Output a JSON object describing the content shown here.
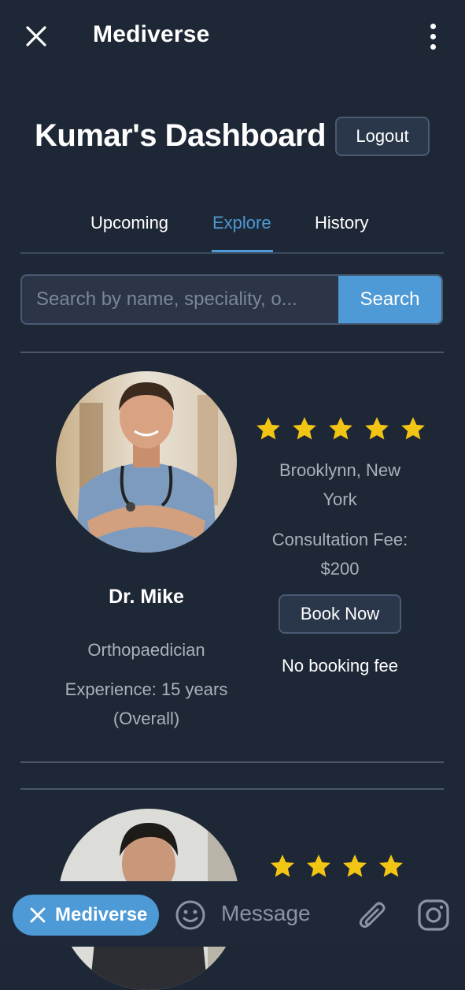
{
  "topbar": {
    "app_title": "Mediverse"
  },
  "dashboard": {
    "title": "Kumar's Dashboard",
    "logout_label": "Logout"
  },
  "tabs": [
    {
      "label": "Upcoming",
      "active": false
    },
    {
      "label": "Explore",
      "active": true
    },
    {
      "label": "History",
      "active": false
    }
  ],
  "search": {
    "placeholder": "Search by name, speciality, o...",
    "button_label": "Search"
  },
  "doctors": [
    {
      "name": "Dr.  Mike",
      "speciality": "Orthopaedician",
      "experience_line1": "Experience: 15 years",
      "experience_line2": "(Overall)",
      "rating": 5,
      "location_line1": "Brooklynn, New",
      "location_line2": "York",
      "fee_line1": "Consultation Fee:",
      "fee_line2": "$200",
      "book_label": "Book Now",
      "booking_note": "No booking fee"
    },
    {
      "rating": 4
    }
  ],
  "bottom_bar": {
    "chip_label": "Mediverse",
    "message_placeholder": "Message"
  },
  "colors": {
    "background": "#1e2735",
    "accent": "#4d9ad6",
    "star": "#f2c515",
    "muted_text": "#a9b1bd"
  }
}
